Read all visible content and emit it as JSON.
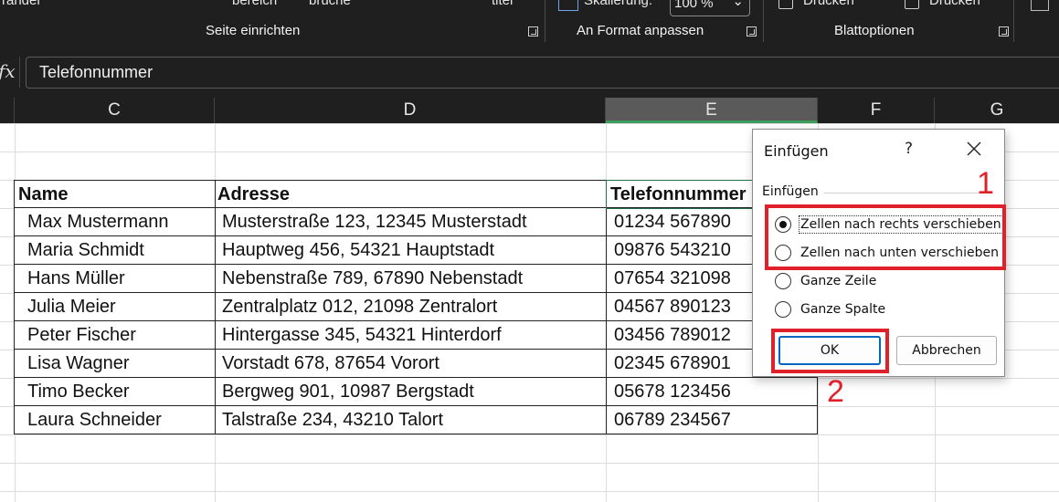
{
  "ribbon": {
    "fragments": [
      "ränder",
      "bereich",
      "brüche",
      "titel"
    ],
    "scaling_label": "Skalierung:",
    "scaling_value": "100 %",
    "drucken_1": "Drucken",
    "drucken_2": "Drucken",
    "groups": [
      "Seite einrichten",
      "An Format anpassen",
      "Blattoptionen"
    ]
  },
  "formula_bar": {
    "fx_label": "fx",
    "value": "Telefonnummer"
  },
  "columns": [
    "C",
    "D",
    "E",
    "F",
    "G"
  ],
  "table": {
    "headers": [
      "Name",
      "Adresse",
      "Telefonnummer"
    ],
    "rows": [
      [
        "Max Mustermann",
        "Musterstraße 123, 12345 Musterstadt",
        "01234 567890"
      ],
      [
        "Maria Schmidt",
        "Hauptweg 456, 54321 Hauptstadt",
        "09876 543210"
      ],
      [
        "Hans Müller",
        "Nebenstraße 789, 67890 Nebenstadt",
        "07654 321098"
      ],
      [
        "Julia Meier",
        "Zentralplatz 012, 21098 Zentralort",
        "04567 890123"
      ],
      [
        "Peter Fischer",
        "Hintergasse 345, 54321 Hinterdorf",
        "03456 789012"
      ],
      [
        "Lisa Wagner",
        "Vorstadt 678, 87654 Vorort",
        "02345 678901"
      ],
      [
        "Timo Becker",
        "Bergweg 901, 10987 Bergstadt",
        "05678 123456"
      ],
      [
        "Laura Schneider",
        "Talstraße 234, 43210 Talort",
        "06789 234567"
      ]
    ]
  },
  "dialog": {
    "title": "Einfügen",
    "help": "?",
    "group_label": "Einfügen",
    "options": [
      {
        "label": "Zellen nach rechts verschieben",
        "selected": true
      },
      {
        "label": "Zellen nach unten verschieben",
        "selected": false
      },
      {
        "label": "Ganze Zeile",
        "selected": false
      },
      {
        "label": "Ganze Spalte",
        "selected": false
      }
    ],
    "ok": "OK",
    "cancel": "Abbrechen"
  },
  "annotations": {
    "step1": "1",
    "step2": "2",
    "color": "#e0202a"
  }
}
